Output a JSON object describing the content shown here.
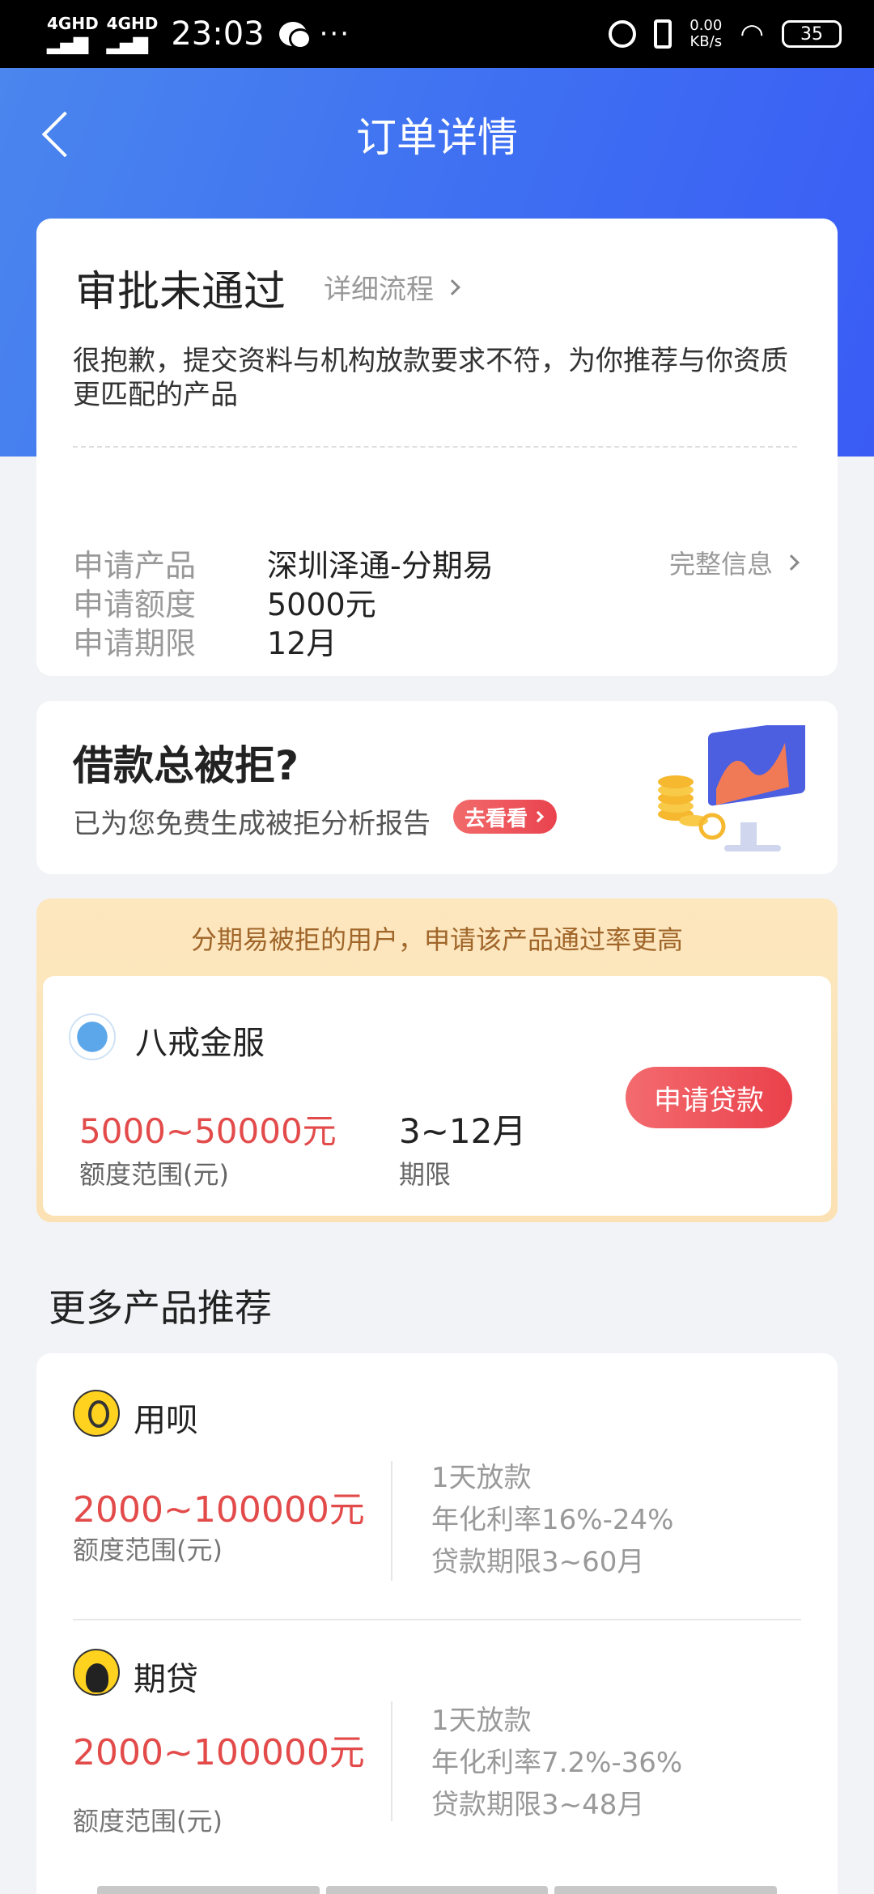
{
  "status_bar": {
    "network1": "4GHD",
    "network2": "4GHD",
    "time": "23:03",
    "more": "···",
    "speed_value": "0.00",
    "speed_unit": "KB/s",
    "battery": "35"
  },
  "header": {
    "title": "订单详情"
  },
  "order": {
    "status": "审批未通过",
    "flow_link": "详细流程",
    "message": "很抱歉，提交资料与机构放款要求不符，为你推荐与你资质更匹配的产品",
    "rows": [
      {
        "label": "申请产品",
        "value": "深圳泽通-分期易"
      },
      {
        "label": "申请额度",
        "value": "5000元"
      },
      {
        "label": "申请期限",
        "value": "12月"
      }
    ],
    "full_info_link": "完整信息"
  },
  "banner": {
    "title": "借款总被拒?",
    "subtitle": "已为您免费生成被拒分析报告",
    "button": "去看看"
  },
  "recommend": {
    "tip": "分期易被拒的用户，申请该产品通过率更高",
    "name": "八戒金服",
    "amount": "5000~50000元",
    "amount_label": "额度范围(元)",
    "term": "3~12月",
    "term_label": "期限",
    "apply_button": "申请贷款"
  },
  "more_section": {
    "title": "更多产品推荐"
  },
  "products": [
    {
      "name": "用呗",
      "amount": "2000~100000元",
      "amount_label": "额度范围(元)",
      "features": [
        "1天放款",
        "年化利率16%-24%",
        "贷款期限3~60月"
      ]
    },
    {
      "name": "期贷",
      "amount": "2000~100000元",
      "amount_label": "额度范围(元)",
      "features": [
        "1天放款",
        "年化利率7.2%-36%",
        "贷款期限3~48月"
      ]
    }
  ],
  "colors": {
    "header_blue": "#3e6ef2",
    "accent_red": "#e34b4b",
    "tip_bg": "#fde7bf"
  },
  "icons": [
    "back-arrow-icon",
    "chevron-right-icon",
    "wechat-icon",
    "alarm-icon",
    "vibrate-icon",
    "wifi-icon",
    "battery-icon"
  ]
}
